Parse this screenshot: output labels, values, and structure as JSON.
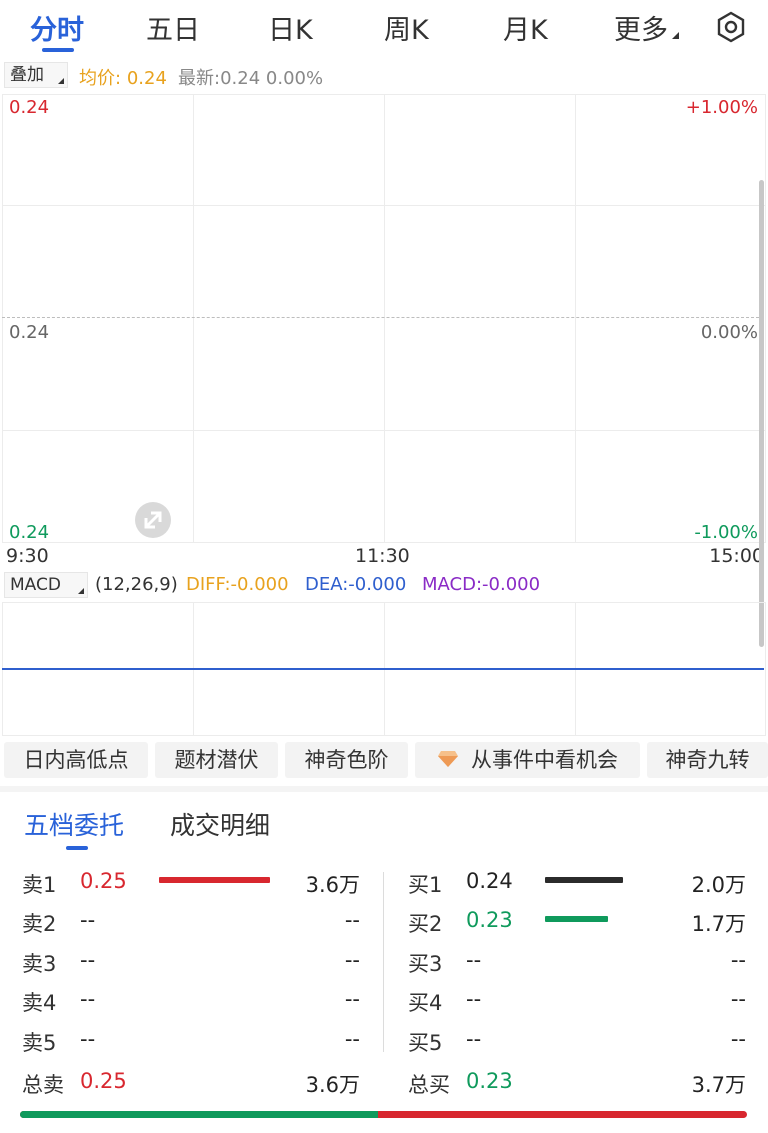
{
  "tabs": [
    "分时",
    "五日",
    "日K",
    "周K",
    "月K",
    "更多"
  ],
  "active_tab": "分时",
  "info": {
    "overlay_label": "叠加",
    "avg_label": "均价:",
    "avg_value": "0.24",
    "latest_label": "最新:",
    "latest_value": "0.24",
    "change": "0.00%"
  },
  "price_chart": {
    "y_left": [
      "0.24",
      "0.24",
      "0.24"
    ],
    "y_right": [
      "+1.00%",
      "0.00%",
      "-1.00%"
    ],
    "x_labels": [
      "9:30",
      "11:30",
      "15:00"
    ]
  },
  "macd": {
    "label": "MACD",
    "params": "(12,26,9)",
    "diff": "DIFF:-0.000",
    "dea": "DEA:-0.000",
    "macd": "MACD:-0.000"
  },
  "chips": [
    "日内高低点",
    "题材潜伏",
    "神奇色阶",
    "从事件中看机会",
    "神奇九转"
  ],
  "orderbook_tabs": [
    "五档委托",
    "成交明细"
  ],
  "sell": [
    {
      "label": "卖1",
      "price": "0.25",
      "volume": "3.6万",
      "level": 0.3
    },
    {
      "label": "卖2",
      "price": "--",
      "volume": "--"
    },
    {
      "label": "卖3",
      "price": "--",
      "volume": "--"
    },
    {
      "label": "卖4",
      "price": "--",
      "volume": "--"
    },
    {
      "label": "卖5",
      "price": "--",
      "volume": "--"
    }
  ],
  "buy": [
    {
      "label": "买1",
      "price": "0.24",
      "volume": "2.0万",
      "level": 0.21
    },
    {
      "label": "买2",
      "price": "0.23",
      "volume": "1.7万",
      "level": 0.17
    },
    {
      "label": "买3",
      "price": "--",
      "volume": "--"
    },
    {
      "label": "买4",
      "price": "--",
      "volume": "--"
    },
    {
      "label": "买5",
      "price": "--",
      "volume": "--"
    }
  ],
  "totals": {
    "sell_label": "总卖",
    "sell_price": "0.25",
    "sell_volume": "3.6万",
    "buy_label": "总买",
    "buy_price": "0.23",
    "buy_volume": "3.7万"
  },
  "ratio_bar": {
    "buy_fraction": 0.493
  },
  "colors": {
    "accent": "#2962d9",
    "up": "#d8272f",
    "down": "#0f9a5c",
    "avg": "#e8a21e",
    "macd": "#8a2bc6",
    "dea_line": "#2f5fce"
  }
}
